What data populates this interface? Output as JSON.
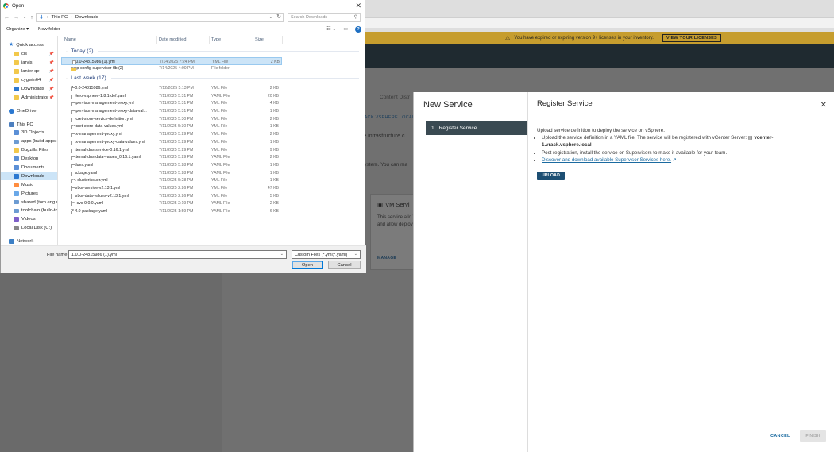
{
  "background": {
    "banner_text": "You have expired or expiring version 9+ licenses in your inventory.",
    "banner_button": "VIEW YOUR LICENSES",
    "tab_label": "Content Distr",
    "link_text": "VACK.VSPHERE.LOCAL",
    "subtitle": "re infrastructure c",
    "subtitle2": "system. You can ma",
    "card": {
      "title": "VM Servi",
      "description": "This service allo VMs and allow deployment.",
      "manage": "MANAGE"
    }
  },
  "modal": {
    "wizard_title": "New Service",
    "step_number": "1",
    "step_label": "Register Service",
    "panel_title": "Register Service",
    "intro": "Upload service definition to deploy the service on vSphere.",
    "bullet1_text": "Upload the service definition in a YAML file. The service will be registered with vCenter Server:",
    "bullet1_server": "vcenter-1.vrack.vsphere.local",
    "bullet2": "Post registration, install the service on Supervisors to make it available for your team.",
    "bullet3_link": "Discover and download available Supervisor Services here.",
    "upload_button": "UPLOAD",
    "cancel_button": "CANCEL",
    "finish_button": "FINISH"
  },
  "dialog": {
    "title": "Open",
    "breadcrumb": [
      "This PC",
      "Downloads"
    ],
    "search_placeholder": "Search Downloads",
    "organize_label": "Organize ▾",
    "new_folder_label": "New folder",
    "help_label": "?",
    "columns": {
      "name": "Name",
      "date": "Date modified",
      "type": "Type",
      "size": "Size"
    },
    "nav": [
      {
        "label": "Quick access",
        "icon": "star-icon"
      },
      {
        "label": "cis",
        "icon": "folder-icon",
        "pinned": true
      },
      {
        "label": "jarvis",
        "icon": "folder-icon",
        "pinned": true
      },
      {
        "label": "lanier-qe",
        "icon": "folder-icon",
        "pinned": true
      },
      {
        "label": "cygwin64",
        "icon": "folder-icon",
        "pinned": true
      },
      {
        "label": "Downloads",
        "icon": "downloads-icon",
        "pinned": true
      },
      {
        "label": "Administrator",
        "icon": "folder-icon",
        "pinned": true
      },
      {
        "label": "OneDrive",
        "icon": "cloud-icon"
      },
      {
        "label": "This PC",
        "icon": "pc-icon"
      },
      {
        "label": "3D Objects",
        "icon": "3d-objects-icon"
      },
      {
        "label": "apps (build-apps.er",
        "icon": "network-drive-icon"
      },
      {
        "label": "Bugzilla Files",
        "icon": "folder-icon"
      },
      {
        "label": "Desktop",
        "icon": "desktop-icon"
      },
      {
        "label": "Documents",
        "icon": "documents-icon"
      },
      {
        "label": "Downloads",
        "icon": "downloads-icon",
        "selected": true
      },
      {
        "label": "Music",
        "icon": "music-icon"
      },
      {
        "label": "Pictures",
        "icon": "pictures-icon"
      },
      {
        "label": "shared (tom.eng.vn",
        "icon": "network-drive-icon"
      },
      {
        "label": "toolchain (build-toc",
        "icon": "network-drive-icon"
      },
      {
        "label": "Videos",
        "icon": "videos-icon"
      },
      {
        "label": "Local Disk (C:)",
        "icon": "drive-icon"
      },
      {
        "label": "Network",
        "icon": "network-icon"
      }
    ],
    "groups": [
      {
        "label": "Today (2)",
        "files": [
          {
            "name": "1.0.0-24815986 (1).yml",
            "date": "7/14/2025 7:24 PM",
            "type": "YML File",
            "size": "2 KB",
            "selected": true
          },
          {
            "name": "wcp-config-supervisor-flb (2)",
            "date": "7/14/2025 4:00 PM",
            "type": "File folder",
            "size": "",
            "folder": true
          }
        ]
      },
      {
        "label": "Last week (17)",
        "files": [
          {
            "name": "1.0.0-24815986.yml",
            "date": "7/12/2025 5:13 PM",
            "type": "YML File",
            "size": "2 KB"
          },
          {
            "name": "velero-vsphere-1.8.1-def.yaml",
            "date": "7/11/2025 5:31 PM",
            "type": "YAML File",
            "size": "20 KB"
          },
          {
            "name": "supervisor-management-proxy.yml",
            "date": "7/11/2025 5:31 PM",
            "type": "YML File",
            "size": "4 KB"
          },
          {
            "name": "supervisor-management-proxy-data-val...",
            "date": "7/11/2025 5:31 PM",
            "type": "YML File",
            "size": "1 KB"
          },
          {
            "name": "secret-store-service-definition.yml",
            "date": "7/11/2025 5:30 PM",
            "type": "YML File",
            "size": "2 KB"
          },
          {
            "name": "secret-store-data-values.yml",
            "date": "7/11/2025 5:30 PM",
            "type": "YML File",
            "size": "1 KB"
          },
          {
            "name": "nsx-management-proxy.yml",
            "date": "7/11/2025 5:29 PM",
            "type": "YML File",
            "size": "2 KB"
          },
          {
            "name": "nsx-management-proxy-data-values.yml",
            "date": "7/11/2025 5:29 PM",
            "type": "YML File",
            "size": "1 KB"
          },
          {
            "name": "external-dns-service-0.16.1.yml",
            "date": "7/11/2025 5:29 PM",
            "type": "YML File",
            "size": "9 KB"
          },
          {
            "name": "external-dns-data-values_0.16.1.yaml",
            "date": "7/11/2025 5:29 PM",
            "type": "YAML File",
            "size": "2 KB"
          },
          {
            "name": "values.yaml",
            "date": "7/11/2025 5:28 PM",
            "type": "YAML File",
            "size": "1 KB"
          },
          {
            "name": "package.yaml",
            "date": "7/11/2025 5:28 PM",
            "type": "YAML File",
            "size": "1 KB"
          },
          {
            "name": "ca-clusterissuer.yml",
            "date": "7/11/2025 5:28 PM",
            "type": "YML File",
            "size": "1 KB"
          },
          {
            "name": "harbor-service-v2.13.1.yml",
            "date": "7/11/2025 2:26 PM",
            "type": "YML File",
            "size": "47 KB"
          },
          {
            "name": "harbor-data-values-v2.13.1.yml",
            "date": "7/11/2025 2:26 PM",
            "type": "YML File",
            "size": "5 KB"
          },
          {
            "name": "lci-svs-9.0.0.yaml",
            "date": "7/11/2025 2:19 PM",
            "type": "YAML File",
            "size": "2 KB"
          },
          {
            "name": "3.4.0-package.yaml",
            "date": "7/11/2025 1:59 PM",
            "type": "YAML File",
            "size": "6 KB"
          }
        ]
      }
    ],
    "file_name_label": "File name:",
    "file_name_value": "1.0.0-24815986 (1).yml",
    "file_type_value": "Custom Files (*.yml;*.yaml)",
    "open_button": "Open",
    "cancel_button": "Cancel"
  }
}
